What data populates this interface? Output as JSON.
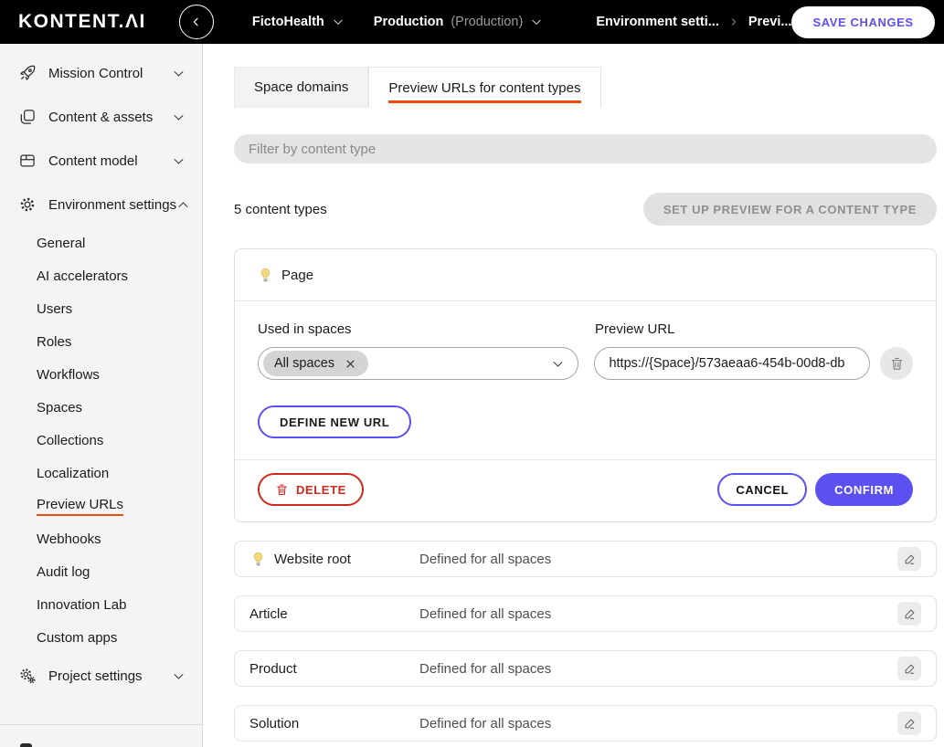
{
  "topbar": {
    "logo": "KONTENT.ΛI",
    "project": "FictoHealth",
    "environment": "Production",
    "environment_suffix": "(Production)",
    "breadcrumb": {
      "level1": "Environment setti...",
      "level2": "Previ..."
    },
    "save_label": "SAVE CHANGES"
  },
  "sidebar": {
    "sections": [
      {
        "label": "Mission Control"
      },
      {
        "label": "Content & assets"
      },
      {
        "label": "Content model"
      },
      {
        "label": "Environment settings"
      },
      {
        "label": "Project settings"
      }
    ],
    "environment_items": [
      "General",
      "AI accelerators",
      "Users",
      "Roles",
      "Workflows",
      "Spaces",
      "Collections",
      "Localization",
      "Preview URLs",
      "Webhooks",
      "Audit log",
      "Innovation Lab",
      "Custom apps"
    ],
    "active_item": "Preview URLs"
  },
  "main": {
    "tabs": [
      {
        "label": "Space domains"
      },
      {
        "label": "Preview URLs for content types"
      }
    ],
    "filter_placeholder": "Filter by content type",
    "count_label": "5 content types",
    "setup_button_label": "SET UP PREVIEW FOR A CONTENT TYPE",
    "editor": {
      "title": "Page",
      "used_in_spaces_label": "Used in spaces",
      "preview_url_label": "Preview URL",
      "space_chip_label": "All spaces",
      "url_value": "https://{Space}/573aeaa6-454b-00d8-db",
      "define_new_url_label": "DEFINE NEW URL",
      "delete_label": "DELETE",
      "cancel_label": "CANCEL",
      "confirm_label": "CONFIRM"
    },
    "rows": [
      {
        "name": "Website root",
        "status": "Defined for all spaces"
      },
      {
        "name": "Article",
        "status": "Defined for all spaces"
      },
      {
        "name": "Product",
        "status": "Defined for all spaces"
      },
      {
        "name": "Solution",
        "status": "Defined for all spaces"
      }
    ]
  },
  "colors": {
    "accent_purple": "#5c50f0",
    "accent_orange": "#f04c0c",
    "danger_red": "#d0281c",
    "topbar_black": "#000000",
    "sidebar_gray": "#f4f4f4"
  }
}
